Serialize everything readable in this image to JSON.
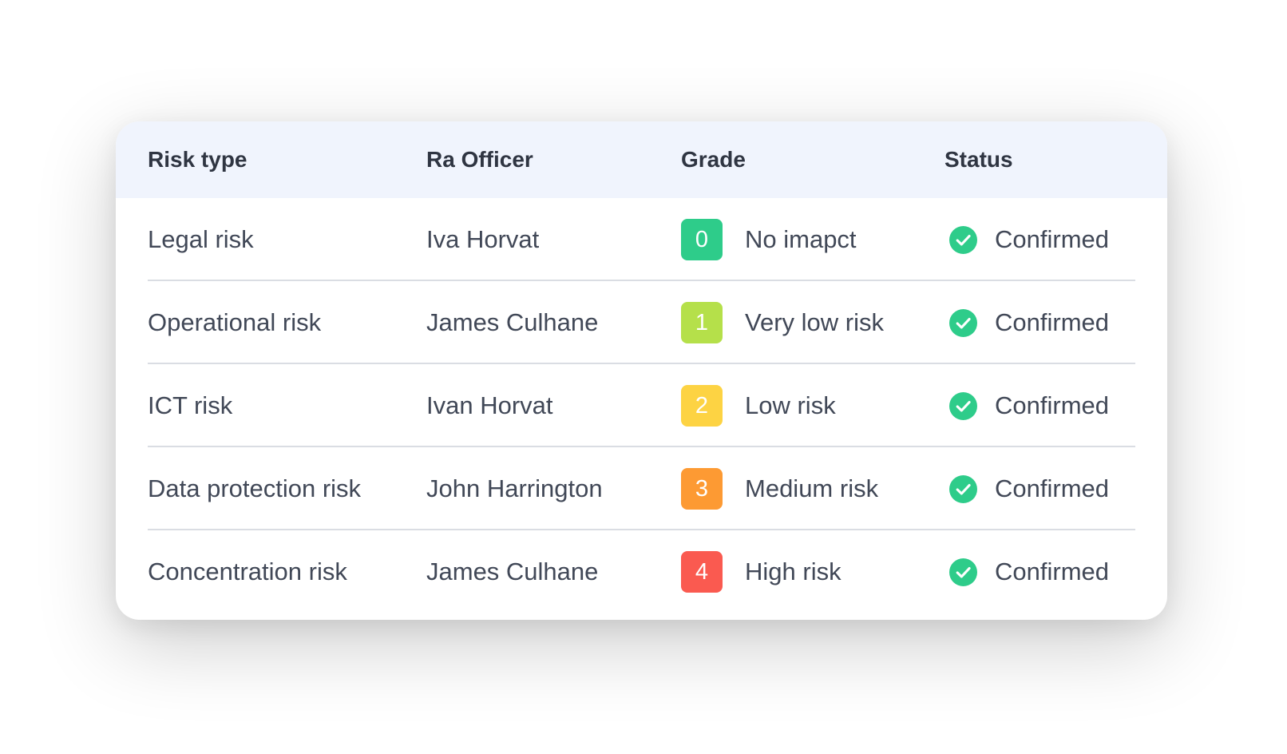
{
  "table": {
    "headers": {
      "risk_type": "Risk type",
      "officer": "Ra Officer",
      "grade": "Grade",
      "status": "Status"
    },
    "rows": [
      {
        "risk_type": "Legal risk",
        "officer": "Iva Horvat",
        "grade_value": "0",
        "grade_label": "No imapct",
        "grade_color": "#2ecc8a",
        "status": "Confirmed"
      },
      {
        "risk_type": "Operational risk",
        "officer": "James Culhane",
        "grade_value": "1",
        "grade_label": "Very low risk",
        "grade_color": "#b5e04a",
        "status": "Confirmed"
      },
      {
        "risk_type": "ICT risk",
        "officer": "Ivan Horvat",
        "grade_value": "2",
        "grade_label": "Low risk",
        "grade_color": "#fdd343",
        "status": "Confirmed"
      },
      {
        "risk_type": "Data protection risk",
        "officer": "John Harrington",
        "grade_value": "3",
        "grade_label": "Medium risk",
        "grade_color": "#fd9a33",
        "status": "Confirmed"
      },
      {
        "risk_type": "Concentration risk",
        "officer": "James Culhane",
        "grade_value": "4",
        "grade_label": "High risk",
        "grade_color": "#fa5a50",
        "status": "Confirmed"
      }
    ],
    "status_color": "#2ecc8a",
    "status_icon": "check-circle-icon"
  }
}
